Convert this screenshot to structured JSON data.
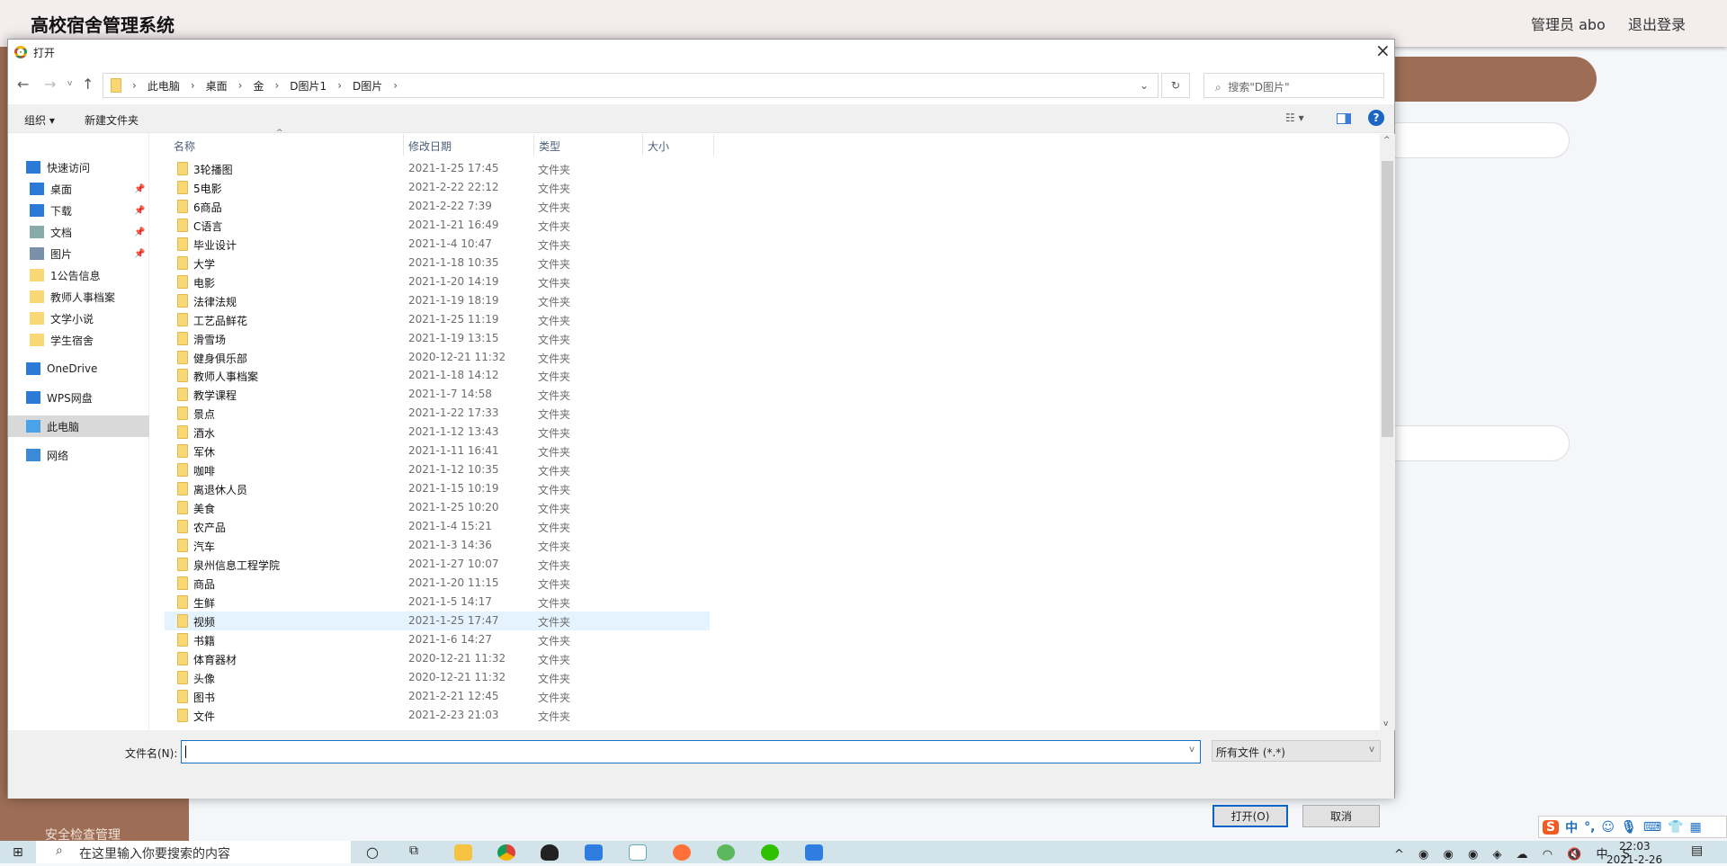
{
  "app": {
    "title": "高校宿舍管理系统",
    "user": "管理员 abo",
    "logout": "退出登录",
    "sidebar_partial": "安全检查管理"
  },
  "dialog": {
    "title": "打开",
    "close": "×",
    "breadcrumb": [
      "此电脑",
      "桌面",
      "金",
      "D图片1",
      "D图片"
    ],
    "search_placeholder": "搜索\"D图片\"",
    "toolbar": {
      "organize": "组织 ▾",
      "new_folder": "新建文件夹"
    },
    "nav": [
      {
        "label": "快速访问",
        "icon": "star-icon"
      },
      {
        "label": "桌面",
        "icon": "desktop-icon",
        "pin": true
      },
      {
        "label": "下载",
        "icon": "download-icon",
        "pin": true
      },
      {
        "label": "文档",
        "icon": "document-icon",
        "pin": true
      },
      {
        "label": "图片",
        "icon": "picture-icon",
        "pin": true
      },
      {
        "label": "1公告信息",
        "icon": "folder-icon"
      },
      {
        "label": "教师人事档案",
        "icon": "folder-icon"
      },
      {
        "label": "文学小说",
        "icon": "folder-icon"
      },
      {
        "label": "学生宿舍",
        "icon": "folder-icon"
      },
      {
        "label": "OneDrive",
        "icon": "cloud-icon"
      },
      {
        "label": "WPS网盘",
        "icon": "cloud-icon"
      },
      {
        "label": "此电脑",
        "icon": "computer-icon",
        "selected": true
      },
      {
        "label": "网络",
        "icon": "network-icon"
      }
    ],
    "columns": [
      "名称",
      "修改日期",
      "类型",
      "大小"
    ],
    "files": [
      [
        "3轮播图",
        "2021-1-25 17:45"
      ],
      [
        "5电影",
        "2021-2-22 22:12"
      ],
      [
        "6商品",
        "2021-2-22 7:39"
      ],
      [
        "C语言",
        "2021-1-21 16:49"
      ],
      [
        "毕业设计",
        "2021-1-4 10:47"
      ],
      [
        "大学",
        "2021-1-18 10:35"
      ],
      [
        "电影",
        "2021-1-20 14:19"
      ],
      [
        "法律法规",
        "2021-1-19 18:19"
      ],
      [
        "工艺品鲜花",
        "2021-1-25 11:19"
      ],
      [
        "滑雪场",
        "2021-1-19 13:15"
      ],
      [
        "健身俱乐部",
        "2020-12-21 11:32"
      ],
      [
        "教师人事档案",
        "2021-1-18 14:12"
      ],
      [
        "教学课程",
        "2021-1-7 14:58"
      ],
      [
        "景点",
        "2021-1-22 17:33"
      ],
      [
        "酒水",
        "2021-1-12 13:43"
      ],
      [
        "军休",
        "2021-1-11 16:41"
      ],
      [
        "咖啡",
        "2021-1-12 10:35"
      ],
      [
        "离退休人员",
        "2021-1-15 10:19"
      ],
      [
        "美食",
        "2021-1-25 10:20"
      ],
      [
        "农产品",
        "2021-1-4 15:21"
      ],
      [
        "汽车",
        "2021-1-3 14:36"
      ],
      [
        "泉州信息工程学院",
        "2021-1-27 10:07"
      ],
      [
        "商品",
        "2021-1-20 11:15"
      ],
      [
        "生鲜",
        "2021-1-5 14:17"
      ],
      [
        "视频",
        "2021-1-25 17:47"
      ],
      [
        "书籍",
        "2021-1-6 14:27"
      ],
      [
        "体育器材",
        "2020-12-21 11:32"
      ],
      [
        "头像",
        "2020-12-21 11:32"
      ],
      [
        "图书",
        "2021-2-21 12:45"
      ],
      [
        "文件",
        "2021-2-23 21:03"
      ]
    ],
    "file_type": "文件夹",
    "hover_index": 24,
    "filename_label": "文件名(N):",
    "filename_value": "",
    "filter": "所有文件 (*.*)",
    "open": "打开(O)",
    "cancel": "取消"
  },
  "taskbar": {
    "search": "在这里输入你要搜索的内容",
    "time": "22:03",
    "date": "2021-2-26",
    "ime": "中"
  }
}
